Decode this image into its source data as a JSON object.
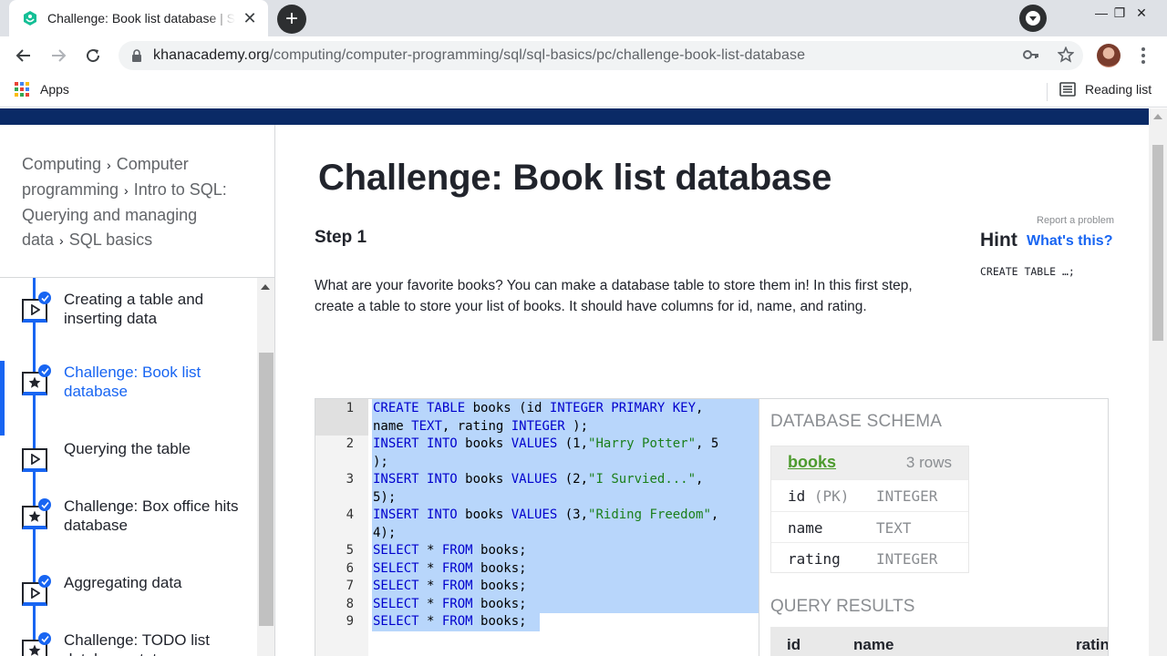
{
  "browser": {
    "tab_title": "Challenge: Book list database | SQL",
    "url_host": "khanacademy.org",
    "url_path": "/computing/computer-programming/sql/sql-basics/pc/challenge-book-list-database",
    "bookmarks": {
      "apps": "Apps",
      "reading_list": "Reading list"
    }
  },
  "sidebar": {
    "breadcrumbs": [
      "Computing",
      "Computer programming",
      "Intro to SQL: Querying and managing data",
      "SQL basics"
    ],
    "lessons": [
      {
        "label": "Creating a table and inserting data",
        "icon": "play-icon",
        "done": true
      },
      {
        "label": "Challenge: Book list database",
        "icon": "star-icon",
        "done": true,
        "active": true
      },
      {
        "label": "Querying the table",
        "icon": "play-icon",
        "done": false
      },
      {
        "label": "Challenge: Box office hits database",
        "icon": "star-icon",
        "done": true
      },
      {
        "label": "Aggregating data",
        "icon": "play-icon",
        "done": true
      },
      {
        "label": "Challenge: TODO list database stats",
        "icon": "star-icon",
        "done": true
      }
    ]
  },
  "main": {
    "title": "Challenge: Book list database",
    "step": "Step 1",
    "report": "Report a problem",
    "hint": "Hint",
    "whats_this": "What's this?",
    "hint_code": "CREATE TABLE …;",
    "description": "What are your favorite books? You can make a database table to store them in! In this first step, create a table to store your list of books. It should have columns for id, name, and rating."
  },
  "editor": {
    "lines": [
      {
        "n": "1",
        "parts": [
          [
            "kw",
            "CREATE TABLE "
          ],
          [
            "",
            "books (id "
          ],
          [
            "kw",
            "INTEGER PRIMARY KEY"
          ],
          [
            "",
            ",\nname "
          ],
          [
            "kw",
            "TEXT"
          ],
          [
            "",
            ", rating "
          ],
          [
            "kw",
            "INTEGER"
          ],
          [
            "",
            " );"
          ]
        ]
      },
      {
        "n": "2",
        "parts": [
          [
            "kw",
            "INSERT INTO "
          ],
          [
            "",
            "books "
          ],
          [
            "kw",
            "VALUES"
          ],
          [
            "",
            " (1,"
          ],
          [
            "str",
            "\"Harry Potter\""
          ],
          [
            "",
            ", 5\n);"
          ]
        ]
      },
      {
        "n": "3",
        "parts": [
          [
            "kw",
            "INSERT INTO "
          ],
          [
            "",
            "books "
          ],
          [
            "kw",
            "VALUES"
          ],
          [
            "",
            " (2,"
          ],
          [
            "str",
            "\"I Survied...\""
          ],
          [
            "",
            ",\n5);"
          ]
        ]
      },
      {
        "n": "4",
        "parts": [
          [
            "kw",
            "INSERT INTO "
          ],
          [
            "",
            "books "
          ],
          [
            "kw",
            "VALUES"
          ],
          [
            "",
            " (3,"
          ],
          [
            "str",
            "\"Riding Freedom\""
          ],
          [
            "",
            ",\n4);"
          ]
        ]
      },
      {
        "n": "5",
        "parts": [
          [
            "kw",
            "SELECT"
          ],
          [
            "",
            " * "
          ],
          [
            "kw",
            "FROM"
          ],
          [
            "",
            " books;"
          ]
        ]
      },
      {
        "n": "6",
        "parts": [
          [
            "kw",
            "SELECT"
          ],
          [
            "",
            " * "
          ],
          [
            "kw",
            "FROM"
          ],
          [
            "",
            " books;"
          ]
        ]
      },
      {
        "n": "7",
        "parts": [
          [
            "kw",
            "SELECT"
          ],
          [
            "",
            " * "
          ],
          [
            "kw",
            "FROM"
          ],
          [
            "",
            " books;"
          ]
        ]
      },
      {
        "n": "8",
        "parts": [
          [
            "kw",
            "SELECT"
          ],
          [
            "",
            " * "
          ],
          [
            "kw",
            "FROM"
          ],
          [
            "",
            " books;"
          ]
        ]
      },
      {
        "n": "9",
        "parts": [
          [
            "kw",
            "SELECT"
          ],
          [
            "",
            " * "
          ],
          [
            "kw",
            "FROM"
          ],
          [
            "",
            " books;"
          ]
        ]
      }
    ]
  },
  "schema": {
    "heading": "DATABASE SCHEMA",
    "table_name": "books",
    "row_count": "3 rows",
    "columns": [
      {
        "name": "id",
        "pk": "(PK)",
        "type": "INTEGER"
      },
      {
        "name": "name",
        "pk": "",
        "type": "TEXT"
      },
      {
        "name": "rating",
        "pk": "",
        "type": "INTEGER"
      }
    ],
    "results_heading": "QUERY RESULTS",
    "results_columns": [
      "id",
      "name",
      "ratin"
    ]
  },
  "colors": {
    "brand_blue": "#1865f2",
    "nav_band": "#0a2a66",
    "selection": "#b8d6fb",
    "table_green": "#4d9b2e"
  }
}
